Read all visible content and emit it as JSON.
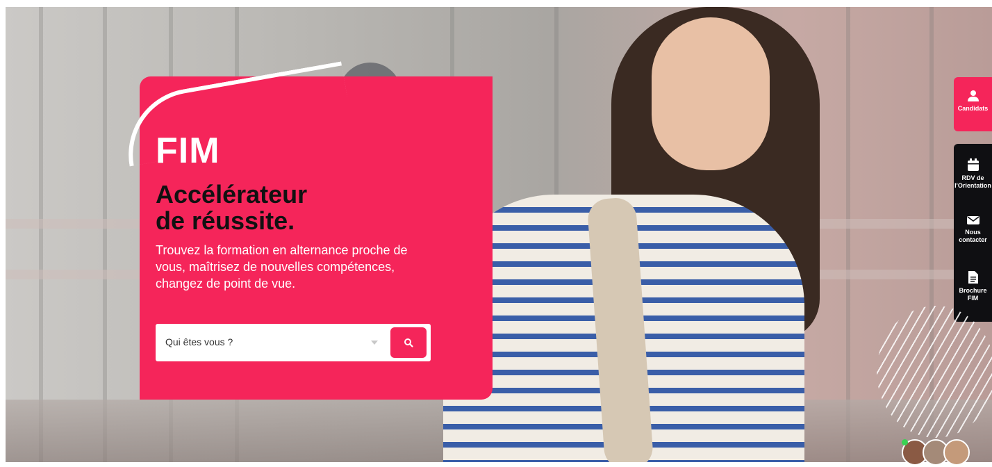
{
  "hero": {
    "brand": "FIM",
    "headline_line1": "Accélérateur",
    "headline_line2": "de réussite.",
    "description": "Trouvez la formation en alternance proche de vous, maîtrisez de nouvelles compétences, changez de point de vue.",
    "search": {
      "select_value": "Qui êtes vous ?",
      "button_icon": "search-icon"
    }
  },
  "side_menu": {
    "candidate": {
      "label": "Candidats",
      "icon": "user-icon"
    },
    "items": [
      {
        "label": "RDV de l'Orientation",
        "icon": "calendar-icon"
      },
      {
        "label": "Nous contacter",
        "icon": "envelope-icon"
      },
      {
        "label": "Brochure FIM",
        "icon": "document-icon"
      }
    ]
  },
  "chat": {
    "status": "online"
  },
  "colors": {
    "accent": "#f5255a",
    "dark_panel": "#0f0f12",
    "text_dark": "#111111"
  }
}
